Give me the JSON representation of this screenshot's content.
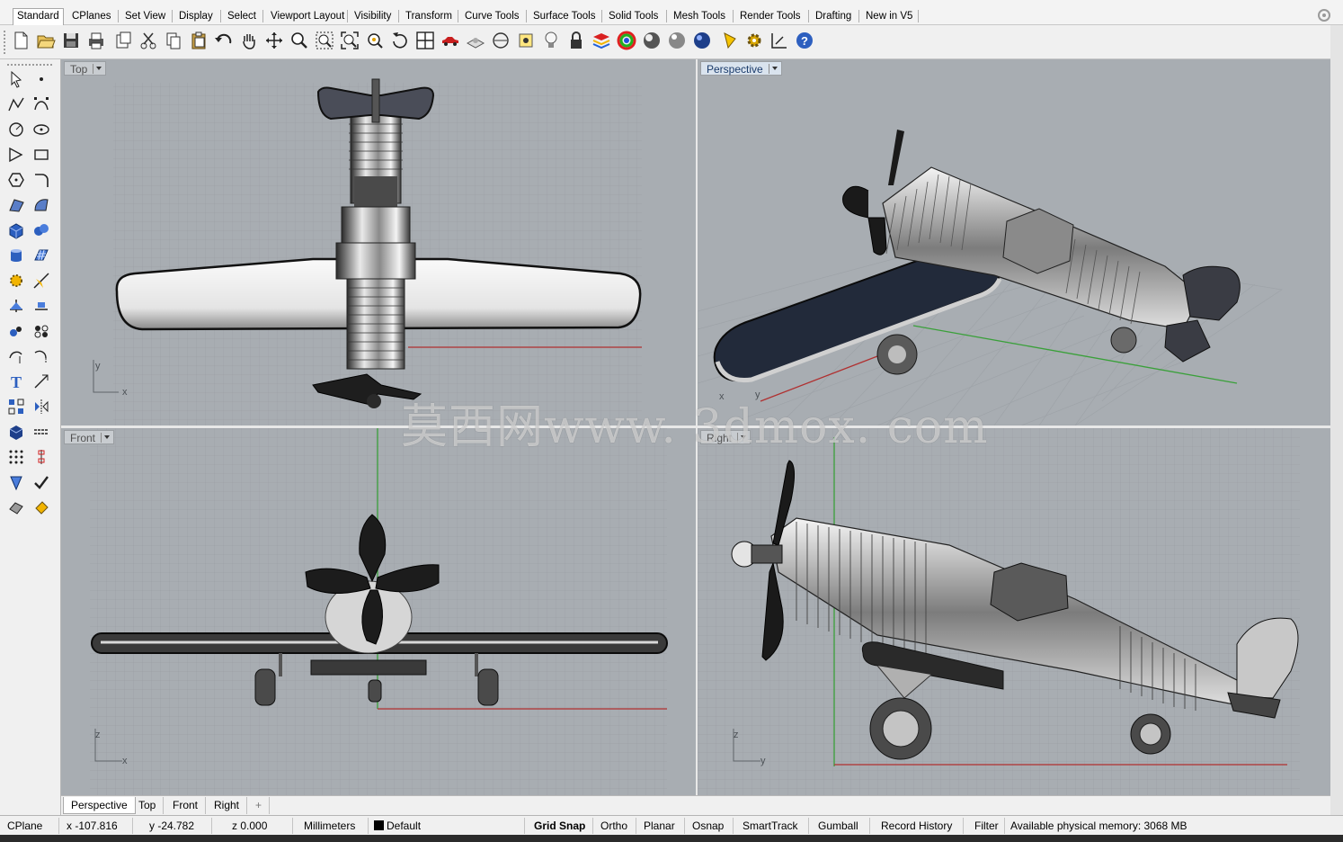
{
  "tabs": [
    "Standard",
    "CPlanes",
    "Set View",
    "Display",
    "Select",
    "Viewport Layout",
    "Visibility",
    "Transform",
    "Curve Tools",
    "Surface Tools",
    "Solid Tools",
    "Mesh Tools",
    "Render Tools",
    "Drafting",
    "New in V5"
  ],
  "active_tab": "Standard",
  "toolbar_icons": [
    "new-file-icon",
    "open-file-icon",
    "save-icon",
    "print-icon",
    "import-icon",
    "cut-icon",
    "copy-icon",
    "paste-icon",
    "undo-icon",
    "pan-hand-icon",
    "move-view-icon",
    "zoom-icon",
    "zoom-window-icon",
    "zoom-extents-icon",
    "zoom-selected-icon",
    "rotate-view-icon",
    "four-views-icon",
    "car-icon",
    "cplane-icon",
    "circle-view-icon",
    "named-cplane-icon",
    "lightbulb-icon",
    "lock-icon",
    "layer-icon",
    "color-wheel-icon",
    "render-sphere-icon",
    "shaded-sphere-icon",
    "rendered-sphere-icon",
    "glossy-sphere-icon",
    "light-cone-icon",
    "options-gear-icon",
    "grid-snap-icon",
    "help-icon"
  ],
  "viewports": {
    "top": {
      "label": "Top",
      "axis_x": "x",
      "axis_y": "y"
    },
    "perspective": {
      "label": "Perspective",
      "axis_x": "x",
      "axis_y": "y"
    },
    "front": {
      "label": "Front",
      "axis_x": "x",
      "axis_y": "z"
    },
    "right": {
      "label": "Right",
      "axis_x": "y",
      "axis_y": "z"
    }
  },
  "viewport_tabs": [
    "Perspective",
    "Top",
    "Front",
    "Right"
  ],
  "add_viewport_tab": "+",
  "status": {
    "cplane": "CPlane",
    "x": "x -107.816",
    "y": "y -24.782",
    "z": "z 0.000",
    "units": "Millimeters",
    "layer": "Default",
    "grid_snap": "Grid Snap",
    "ortho": "Ortho",
    "planar": "Planar",
    "osnap": "Osnap",
    "smarttrack": "SmartTrack",
    "gumball": "Gumball",
    "record_history": "Record History",
    "filter": "Filter",
    "memory": "Available physical memory: 3068 MB"
  },
  "watermark": "莫西网www. 3dmox. com"
}
